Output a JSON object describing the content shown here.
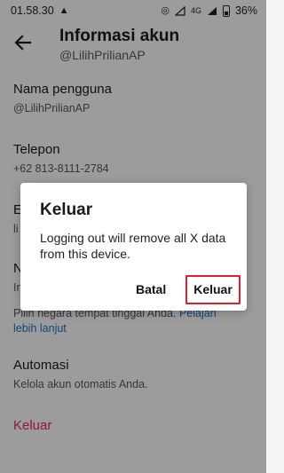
{
  "status_bar": {
    "time": "01.58.30",
    "warning_icon": "warning-triangle-icon",
    "network_label": "4G",
    "battery": "36%"
  },
  "header": {
    "title": "Informasi akun",
    "subtitle": "@LilihPrilianAP"
  },
  "settings": {
    "username_label": "Nama pengguna",
    "username_value": "@LilihPrilianAP",
    "phone_label": "Telepon",
    "phone_value": "+62 813-8111-2784",
    "email_label_partial": "E",
    "email_value_partial": "li",
    "country_label_partial": "N",
    "country_value_partial": "In",
    "country_desc": "Pilih negara tempat tinggal Anda.",
    "country_link": "Pelajari",
    "country_link_line2": "lebih lanjut",
    "automation_label": "Automasi",
    "automation_value": "Kelola akun otomatis Anda.",
    "logout_label": "Keluar"
  },
  "dialog": {
    "title": "Keluar",
    "message": "Logging out will remove all X data from this device.",
    "cancel_label": "Batal",
    "confirm_label": "Keluar"
  },
  "colors": {
    "danger": "#e0245e",
    "link": "#1d6fb8",
    "highlight_box": "#e0202b"
  }
}
